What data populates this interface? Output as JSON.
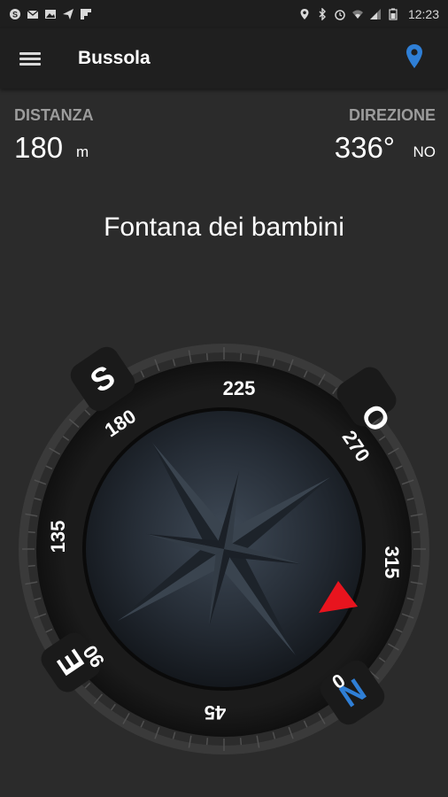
{
  "status_bar": {
    "left_icons": [
      "skype-icon",
      "mail-icon",
      "image-icon",
      "send-icon",
      "flipboard-icon"
    ],
    "right_icons": [
      "location-icon",
      "bluetooth-icon",
      "alarm-icon",
      "wifi-icon",
      "signal-icon",
      "battery-icon"
    ],
    "time": "12:23"
  },
  "toolbar": {
    "title": "Bussola",
    "menu_icon": "hamburger-icon",
    "location_icon": "map-pin-icon"
  },
  "info": {
    "distance_label": "DISTANZA",
    "distance_value": "180",
    "distance_unit": "m",
    "direction_label": "DIREZIONE",
    "direction_value": "336°",
    "direction_cardinal": "NO"
  },
  "destination": "Fontana dei bambini",
  "compass": {
    "degree_labels": [
      "0",
      "45",
      "90",
      "135",
      "180",
      "225",
      "270",
      "315"
    ],
    "cardinal_labels": {
      "N": "N",
      "E": "E",
      "S": "S",
      "O": "O"
    },
    "heading_marker_color": "#e8141e",
    "north_color": "#2f7fd6"
  },
  "colors": {
    "background": "#2b2b2b",
    "toolbar": "#1f1f1f",
    "label_gray": "#9c9c9c",
    "accent_blue": "#2f7fd6"
  }
}
